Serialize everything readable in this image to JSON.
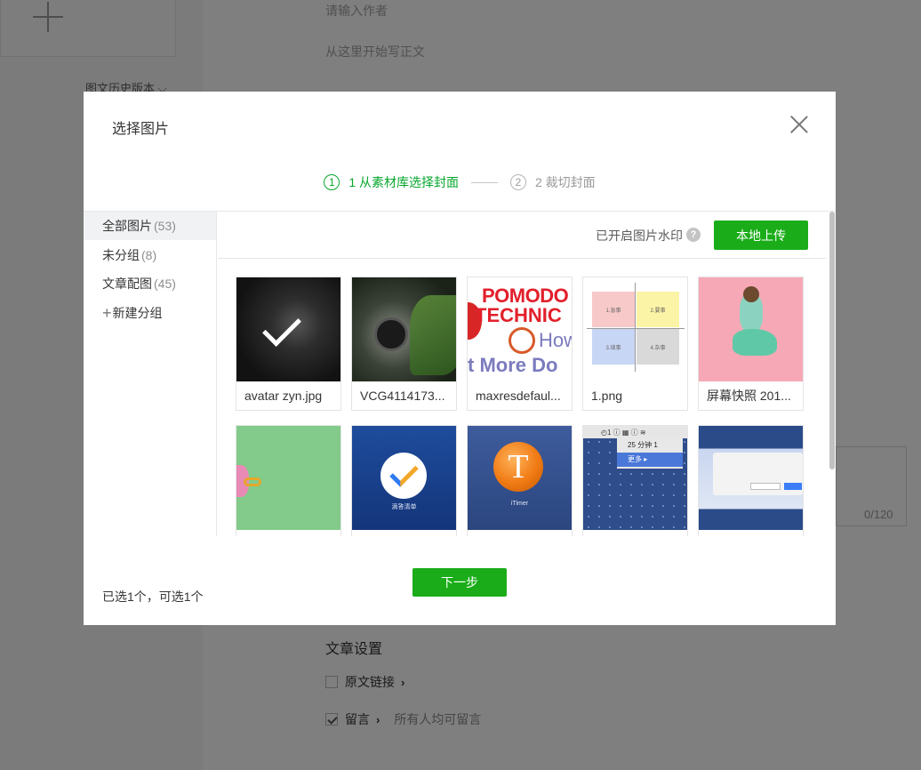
{
  "background": {
    "history_versions": "图文历史版本 ⌵",
    "author_placeholder": "请输入作者",
    "body_placeholder": "从这里开始写正文",
    "summary_counter": "0/120",
    "settings_title": "文章设置",
    "original_link_label": "原文链接",
    "comment_label": "留言",
    "comment_hint": "所有人均可留言",
    "chevron": "›"
  },
  "dialog": {
    "title": "选择图片",
    "steps": [
      {
        "num": "1",
        "label": "1 从素材库选择封面",
        "active": true
      },
      {
        "num": "2",
        "label": "2 裁切封面",
        "active": false
      }
    ],
    "sidebar": {
      "items": [
        {
          "label": "全部图片",
          "count": "(53)",
          "active": true
        },
        {
          "label": "未分组",
          "count": "(8)",
          "active": false
        },
        {
          "label": "文章配图",
          "count": "(45)",
          "active": false
        }
      ],
      "add_group": "新建分组",
      "add_plus": "+"
    },
    "toolbar": {
      "watermark_text": "已开启图片水印",
      "help_icon": "?",
      "upload_label": "本地上传"
    },
    "images": [
      {
        "caption": "avatar zyn.jpg",
        "selected": true
      },
      {
        "caption": "VCG4114173...",
        "selected": false
      },
      {
        "caption": "maxresdefaul...",
        "selected": false
      },
      {
        "caption": "1.png",
        "selected": false
      },
      {
        "caption": "屏幕快照 201...",
        "selected": false
      },
      {
        "caption": "",
        "selected": false
      },
      {
        "caption": "",
        "selected": false
      },
      {
        "caption": "",
        "selected": false
      },
      {
        "caption": "",
        "selected": false
      },
      {
        "caption": "",
        "selected": false
      }
    ],
    "thumb_text": {
      "pomo_line1": "POMODO",
      "pomo_line2": "TECHNIC",
      "pomo_how": "How",
      "pomo_more": "t More Do",
      "png_q1": "1.急事",
      "png_q2": "2.要事",
      "png_q3": "3.琐事",
      "png_q4": "4.杂事",
      "tick_label": "滴答清单",
      "itimer_letter": "T",
      "itimer_label": "iTimer",
      "menu_bar": "◴1  ⓘ  ▦  ⓘ  ≋",
      "menu_item1": "25 分钟        1",
      "menu_item2": "更多              ▸"
    },
    "selected_info": "已选1个，可选1个",
    "next_label": "下一步"
  },
  "colors": {
    "accent_green": "#1aad19",
    "step_active": "#07a72d",
    "overlay": "rgba(0,0,0,0.5)"
  }
}
